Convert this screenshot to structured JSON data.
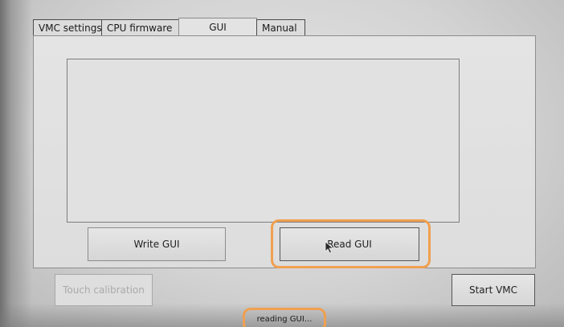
{
  "tabs": [
    {
      "label": "VMC settings",
      "active": false
    },
    {
      "label": "CPU firmware",
      "active": false
    },
    {
      "label": "GUI",
      "active": true
    },
    {
      "label": "Manual",
      "active": false
    }
  ],
  "gui_panel": {
    "log_text": "",
    "write_button": "Write GUI",
    "read_button": "Read GUI"
  },
  "footer": {
    "touch_calibration_button": "Touch calibration",
    "touch_calibration_enabled": false,
    "start_button": "Start VMC",
    "status_text": "reading GUI..."
  },
  "highlight_color": "#f0a050",
  "icons": [
    "mouse-cursor-icon"
  ]
}
